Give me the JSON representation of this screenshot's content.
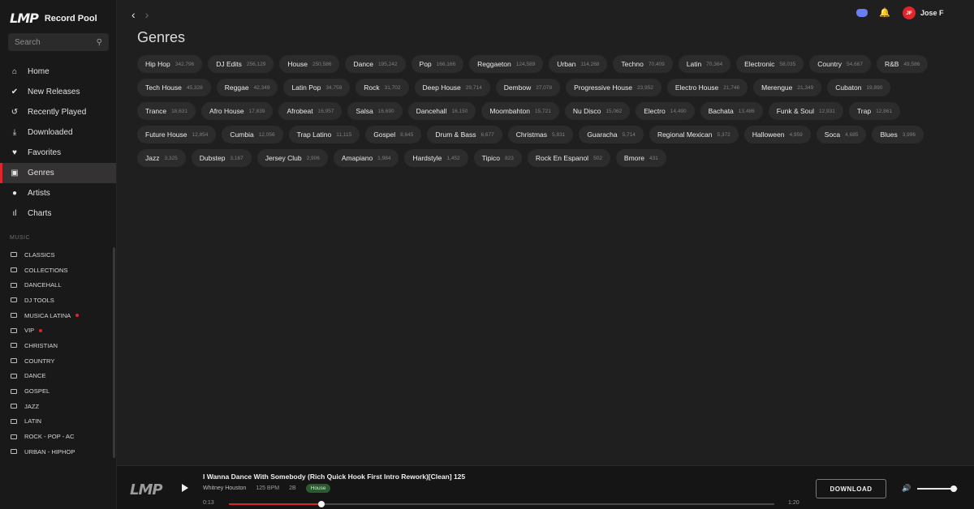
{
  "brand": {
    "logo": "LMP",
    "name": "Record Pool"
  },
  "search": {
    "placeholder": "Search",
    "icon": "search-icon"
  },
  "nav": [
    {
      "label": "Home",
      "icon": "home-icon",
      "glyph": "⌂",
      "active": false
    },
    {
      "label": "New Releases",
      "icon": "badge-check-icon",
      "glyph": "✔",
      "active": false
    },
    {
      "label": "Recently Played",
      "icon": "history-icon",
      "glyph": "↺",
      "active": false
    },
    {
      "label": "Downloaded",
      "icon": "download-icon",
      "glyph": "⤓",
      "active": false
    },
    {
      "label": "Favorites",
      "icon": "heart-icon",
      "glyph": "♥",
      "active": false
    },
    {
      "label": "Genres",
      "icon": "library-icon",
      "glyph": "▣",
      "active": true
    },
    {
      "label": "Artists",
      "icon": "user-icon",
      "glyph": "●",
      "active": false
    },
    {
      "label": "Charts",
      "icon": "bar-chart-icon",
      "glyph": "ıl",
      "active": false
    }
  ],
  "music_section_label": "MUSIC",
  "folders": [
    {
      "label": "CLASSICS",
      "dot": false
    },
    {
      "label": "COLLECTIONS",
      "dot": false
    },
    {
      "label": "DANCEHALL",
      "dot": false
    },
    {
      "label": "DJ TOOLS",
      "dot": false
    },
    {
      "label": "MUSICA LATINA",
      "dot": true
    },
    {
      "label": "VIP",
      "dot": true
    },
    {
      "label": "CHRISTIAN",
      "dot": false
    },
    {
      "label": "COUNTRY",
      "dot": false
    },
    {
      "label": "DANCE",
      "dot": false
    },
    {
      "label": "GOSPEL",
      "dot": false
    },
    {
      "label": "JAZZ",
      "dot": false
    },
    {
      "label": "LATIN",
      "dot": false
    },
    {
      "label": "ROCK - POP - AC",
      "dot": false
    },
    {
      "label": "URBAN - HIPHOP",
      "dot": false
    }
  ],
  "topbar": {
    "back": "‹",
    "forward": "›",
    "user_initials": "JF",
    "user_name": "Jose F"
  },
  "page_title": "Genres",
  "genres": [
    {
      "name": "Hip Hop",
      "count": "342,796"
    },
    {
      "name": "DJ Edits",
      "count": "256,129"
    },
    {
      "name": "House",
      "count": "250,586"
    },
    {
      "name": "Dance",
      "count": "195,242"
    },
    {
      "name": "Pop",
      "count": "166,166"
    },
    {
      "name": "Reggaeton",
      "count": "124,589"
    },
    {
      "name": "Urban",
      "count": "114,268"
    },
    {
      "name": "Techno",
      "count": "70,409"
    },
    {
      "name": "Latin",
      "count": "70,364"
    },
    {
      "name": "Electronic",
      "count": "58,035"
    },
    {
      "name": "Country",
      "count": "54,667"
    },
    {
      "name": "R&B",
      "count": "49,586"
    },
    {
      "name": "Tech House",
      "count": "45,328"
    },
    {
      "name": "Reggae",
      "count": "42,349"
    },
    {
      "name": "Latin Pop",
      "count": "34,759"
    },
    {
      "name": "Rock",
      "count": "31,702"
    },
    {
      "name": "Deep House",
      "count": "29,714"
    },
    {
      "name": "Dembow",
      "count": "27,078"
    },
    {
      "name": "Progressive House",
      "count": "23,952"
    },
    {
      "name": "Electro House",
      "count": "21,746"
    },
    {
      "name": "Merengue",
      "count": "21,349"
    },
    {
      "name": "Cubaton",
      "count": "19,890"
    },
    {
      "name": "Trance",
      "count": "18,631"
    },
    {
      "name": "Afro House",
      "count": "17,839"
    },
    {
      "name": "Afrobeat",
      "count": "16,957"
    },
    {
      "name": "Salsa",
      "count": "16,690"
    },
    {
      "name": "Dancehall",
      "count": "16,150"
    },
    {
      "name": "Moombahton",
      "count": "15,721"
    },
    {
      "name": "Nu Disco",
      "count": "15,062"
    },
    {
      "name": "Electro",
      "count": "14,490"
    },
    {
      "name": "Bachata",
      "count": "13,486"
    },
    {
      "name": "Funk & Soul",
      "count": "12,931"
    },
    {
      "name": "Trap",
      "count": "12,861"
    },
    {
      "name": "Future House",
      "count": "12,854"
    },
    {
      "name": "Cumbia",
      "count": "12,056"
    },
    {
      "name": "Trap Latino",
      "count": "11,115"
    },
    {
      "name": "Gospel",
      "count": "8,645"
    },
    {
      "name": "Drum & Bass",
      "count": "6,677"
    },
    {
      "name": "Christmas",
      "count": "5,831"
    },
    {
      "name": "Guaracha",
      "count": "5,714"
    },
    {
      "name": "Regional Mexican",
      "count": "5,372"
    },
    {
      "name": "Halloween",
      "count": "4,959"
    },
    {
      "name": "Soca",
      "count": "4,685"
    },
    {
      "name": "Blues",
      "count": "3,996"
    },
    {
      "name": "Jazz",
      "count": "3,325"
    },
    {
      "name": "Dubstep",
      "count": "3,167"
    },
    {
      "name": "Jersey Club",
      "count": "2,906"
    },
    {
      "name": "Amapiano",
      "count": "1,984"
    },
    {
      "name": "Hardstyle",
      "count": "1,452"
    },
    {
      "name": "Tipico",
      "count": "823"
    },
    {
      "name": "Rock En Espanol",
      "count": "502"
    },
    {
      "name": "Bmore",
      "count": "431"
    }
  ],
  "player": {
    "logo": "LMP",
    "title": "I Wanna Dance With Somebody (Rich Quick Hook First Intro Rework)[Clean] 125",
    "artist": "Whitney Houston",
    "bpm": "125 BPM",
    "key": "2B",
    "genre_tag": "House",
    "time_current": "0:13",
    "time_total": "1:20",
    "progress_fraction": 0.17,
    "download_label": "DOWNLOAD",
    "volume_fraction": 0.9
  },
  "colors": {
    "accent": "#e0262b",
    "tag_bg": "#2c5a30",
    "discord": "#6b7df2"
  }
}
